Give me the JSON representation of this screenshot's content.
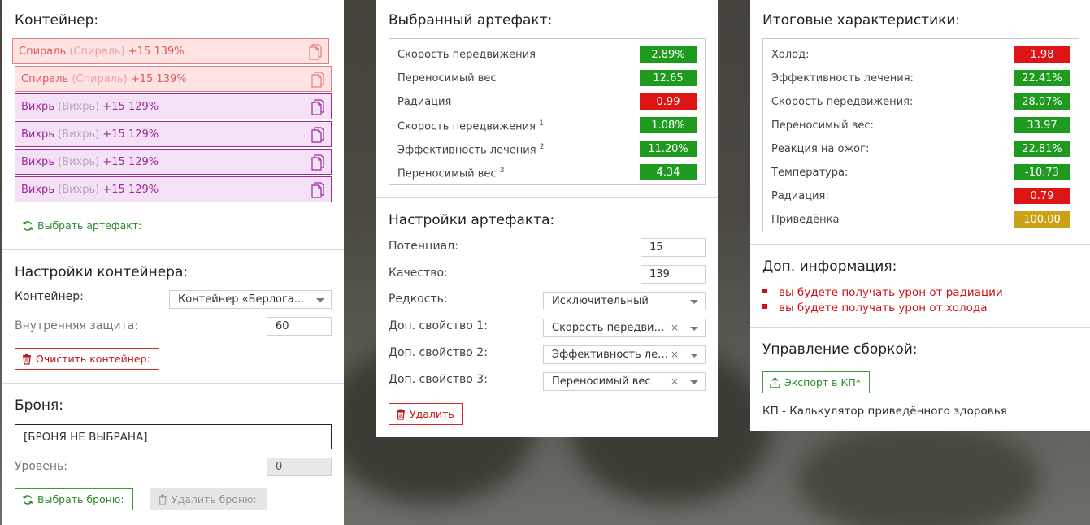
{
  "colors": {
    "green": "#1e9a1e",
    "red": "#dd1515",
    "gold": "#c9a315",
    "artifact_red": "#e05a5a",
    "artifact_purple": "#9b2a9b"
  },
  "container": {
    "title": "Контейнер:",
    "artifacts": [
      {
        "name": "Спираль",
        "sub": "(Спираль)",
        "bonus": "+15 139%"
      },
      {
        "name": "Спираль",
        "sub": "(Спираль)",
        "bonus": "+15 139%"
      },
      {
        "name": "Вихрь",
        "sub": "(Вихрь)",
        "bonus": "+15 129%"
      },
      {
        "name": "Вихрь",
        "sub": "(Вихрь)",
        "bonus": "+15 129%"
      },
      {
        "name": "Вихрь",
        "sub": "(Вихрь)",
        "bonus": "+15 129%"
      },
      {
        "name": "Вихрь",
        "sub": "(Вихрь)",
        "bonus": "+15 129%"
      }
    ],
    "select_artifact_label": "Выбрать артефакт:"
  },
  "container_settings": {
    "title": "Настройки контейнера:",
    "container_label": "Контейнер:",
    "container_value": "Контейнер «Берлога...",
    "protection_label": "Внутренняя защита:",
    "protection_value": "60",
    "clear_label": "Очистить контейнер:"
  },
  "armor": {
    "title": "Броня:",
    "value": "[БРОНЯ НЕ ВЫБРАНА]",
    "level_label": "Уровень:",
    "level_value": "0",
    "select_label": "Выбрать броню:",
    "delete_label": "Удалить броню:"
  },
  "selected_artifact": {
    "title": "Выбранный артефакт:",
    "stats": [
      {
        "name": "Скорость передвижения",
        "sup": "",
        "value": "2.89%",
        "color": "green"
      },
      {
        "name": "Переносимый вес",
        "sup": "",
        "value": "12.65",
        "color": "green"
      },
      {
        "name": "Радиация",
        "sup": "",
        "value": "0.99",
        "color": "red"
      },
      {
        "name": "Скорость передвижения",
        "sup": "1",
        "value": "1.08%",
        "color": "green"
      },
      {
        "name": "Эффективность лечения",
        "sup": "2",
        "value": "11.20%",
        "color": "green"
      },
      {
        "name": "Переносимый вес",
        "sup": "3",
        "value": "4.34",
        "color": "green"
      }
    ]
  },
  "artifact_settings": {
    "title": "Настройки артефакта:",
    "potential_label": "Потенциал:",
    "potential_value": "15",
    "quality_label": "Качество:",
    "quality_value": "139",
    "rarity_label": "Редкость:",
    "rarity_value": "Исключительный",
    "prop1_label": "Доп. свойство 1:",
    "prop1_value": "Скорость передвижения",
    "prop2_label": "Доп. свойство 2:",
    "prop2_value": "Эффективность лечения",
    "prop3_label": "Доп. свойство 3:",
    "prop3_value": "Переносимый вес",
    "clear_symbol": "×",
    "delete_label": "Удалить"
  },
  "totals": {
    "title": "Итоговые характеристики:",
    "stats": [
      {
        "name": "Холод:",
        "value": "1.98",
        "color": "red"
      },
      {
        "name": "Эффективность лечения:",
        "value": "22.41%",
        "color": "green"
      },
      {
        "name": "Скорость передвижения:",
        "value": "28.07%",
        "color": "green"
      },
      {
        "name": "Переносимый вес:",
        "value": "33.97",
        "color": "green"
      },
      {
        "name": "Реакция на ожог:",
        "value": "22.81%",
        "color": "green"
      },
      {
        "name": "Температура:",
        "value": "-10.73",
        "color": "green"
      },
      {
        "name": "Радиация:",
        "value": "0.79",
        "color": "red"
      },
      {
        "name": "Приведёнка",
        "value": "100.00",
        "color": "gold"
      }
    ]
  },
  "extra_info": {
    "title": "Доп. информация:",
    "items": [
      "вы будете получать урон от радиации",
      "вы будете получать урон от холода"
    ]
  },
  "build": {
    "title": "Управление сборкой:",
    "export_label": "Экспорт в КП*",
    "footnote": "КП - Калькулятор приведённого здоровья"
  }
}
